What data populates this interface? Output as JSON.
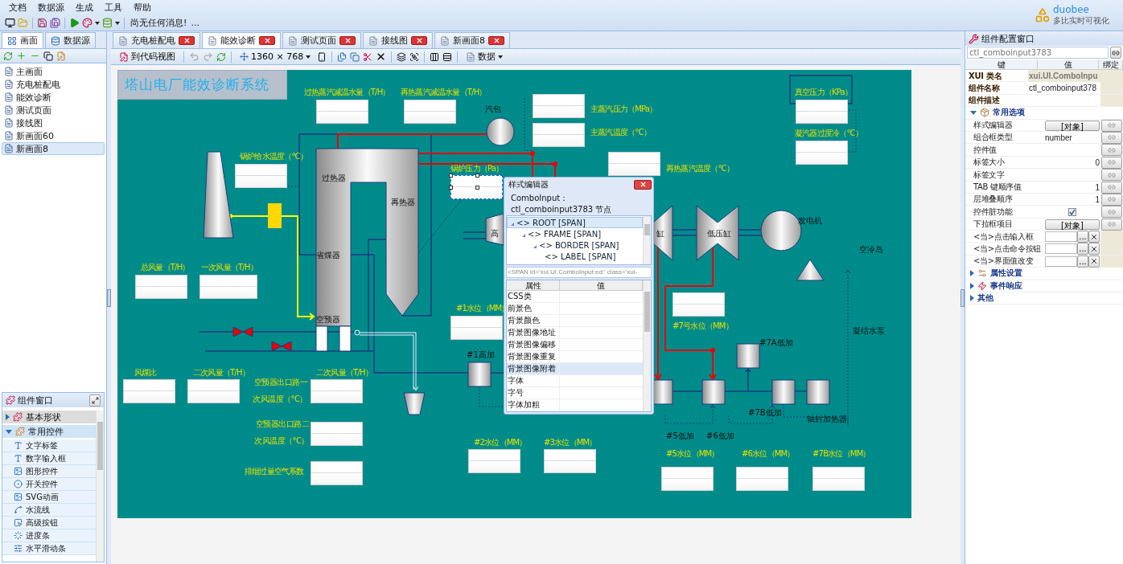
{
  "menu": [
    "文档",
    "数据源",
    "生成",
    "工具",
    "帮助"
  ],
  "toolbar": {
    "message": "尚无任何消息!",
    "more": "..."
  },
  "logo": {
    "name": "duobee",
    "tagline": "多比实时可视化"
  },
  "left_tabs": [
    {
      "label": "画面",
      "selected": true
    },
    {
      "label": "数据源",
      "selected": false
    }
  ],
  "pages": [
    {
      "label": "主画面",
      "selected": false
    },
    {
      "label": "充电桩配电",
      "selected": false
    },
    {
      "label": "能效诊断",
      "selected": false
    },
    {
      "label": "测试页面",
      "selected": false
    },
    {
      "label": "接线图",
      "selected": false
    },
    {
      "label": "新画面60",
      "selected": false
    },
    {
      "label": "新画面8",
      "selected": true
    }
  ],
  "component_window": {
    "title": "组件窗口",
    "groups": [
      {
        "label": "基本形状",
        "expanded": false
      },
      {
        "label": "常用控件",
        "expanded": true,
        "items": [
          "文字标签",
          "数字输入框",
          "图形控件",
          "开关控件",
          "SVG动画",
          "水流线",
          "高级按钮",
          "进度条",
          "水平滑动条"
        ]
      }
    ]
  },
  "doc_tabs": [
    {
      "label": "充电桩配电",
      "selected": false
    },
    {
      "label": "能效诊断",
      "selected": true
    },
    {
      "label": "测试页面",
      "selected": false
    },
    {
      "label": "接线图",
      "selected": false
    },
    {
      "label": "新画面8",
      "selected": false
    }
  ],
  "editor_toolbar": {
    "code_view": "到代码视图",
    "size": "1360 × 768",
    "data": "数据"
  },
  "canvas": {
    "title": "塔山电厂能效诊断系统",
    "gauges": [
      {
        "label": "过热蒸汽减温水量（T/H）",
        "selected": false
      },
      {
        "label": "再热蒸汽减温水量（T/H）",
        "selected": false
      },
      {
        "label": "主蒸汽压力（MPa）",
        "selected": false
      },
      {
        "label": "主蒸汽温度（°C）",
        "selected": false
      },
      {
        "label": "再热蒸汽温度（°C）",
        "selected": false
      },
      {
        "label": "真空压力（KPa）",
        "selected": false
      },
      {
        "label": "凝汽器过度冷（°C）",
        "selected": false
      },
      {
        "label": "锅炉给水温度（°C）",
        "selected": false
      },
      {
        "label": "锅炉压力（Pa）",
        "selected": true
      },
      {
        "label": "总风量（T/H）",
        "selected": false
      },
      {
        "label": "一次风量（T/H）",
        "selected": false
      },
      {
        "label": "#1水位（MM）",
        "selected": false
      },
      {
        "label": "#7号水位（MM）",
        "selected": false
      },
      {
        "label": "风煤比",
        "selected": false
      },
      {
        "label": "二次风量（T/H）",
        "selected": false
      },
      {
        "label": "二次风量（T/H）",
        "selected": false
      },
      {
        "label": "空预器出口路二次风温度（°C）",
        "selected": false
      },
      {
        "label": "排烟过量空气系数",
        "selected": false
      },
      {
        "label": "#2水位（MM）",
        "selected": false
      },
      {
        "label": "#3水位（MM）",
        "selected": false
      },
      {
        "label": "#5水位（MM）",
        "selected": false
      },
      {
        "label": "#6水位（MM）",
        "selected": false
      },
      {
        "label": "#7B水位（MM）",
        "selected": false
      }
    ],
    "labels": [
      {
        "text": "汽包",
        "kind": "equipment"
      },
      {
        "text": "过热器",
        "kind": "equipment"
      },
      {
        "text": "再热器",
        "kind": "equipment"
      },
      {
        "text": "省煤器",
        "kind": "equipment"
      },
      {
        "text": "空预器",
        "kind": "equipment"
      },
      {
        "text": "空预器出口路一次风温度（°C）",
        "kind": "gauge"
      },
      {
        "text": "高",
        "kind": "equipment"
      },
      {
        "text": "缸",
        "kind": "equipment"
      },
      {
        "text": "低压缸",
        "kind": "equipment"
      },
      {
        "text": "发电机",
        "kind": "equipment"
      },
      {
        "text": "空冷岛",
        "kind": "equipment"
      },
      {
        "text": "凝结水泵",
        "kind": "equipment"
      },
      {
        "text": "#1高加",
        "kind": "equipment"
      },
      {
        "text": "#7A低加",
        "kind": "equipment"
      },
      {
        "text": "#7B低加",
        "kind": "equipment"
      },
      {
        "text": "#5低加",
        "kind": "equipment"
      },
      {
        "text": "#6低加",
        "kind": "equipment"
      },
      {
        "text": "轴封加热器",
        "kind": "equipment"
      }
    ]
  },
  "style_editor": {
    "title": "样式编辑器",
    "subtitle": "ComboInput：ctl_comboinput3783 节点",
    "tree": [
      {
        "label": "<> ROOT [SPAN]",
        "selected": true,
        "expanded": true,
        "children": [
          {
            "label": "<> FRAME [SPAN]",
            "selected": false,
            "expanded": true,
            "children": [
              {
                "label": "<> BORDER [SPAN]",
                "selected": false,
                "expanded": true,
                "children": [
                  {
                    "label": "<> LABEL [SPAN]",
                    "selected": false
                  }
                ]
              }
            ]
          }
        ]
      }
    ],
    "path": "<SPAN id='xui.UI.ComboInput:ed:' class='xui-",
    "columns": [
      "属性",
      "值"
    ],
    "rows": [
      {
        "label": "CSS类",
        "selected": false
      },
      {
        "label": "前景色",
        "selected": false
      },
      {
        "label": "背景颜色",
        "selected": false
      },
      {
        "label": "背景图像地址",
        "selected": false
      },
      {
        "label": "背景图像偏移",
        "selected": false
      },
      {
        "label": "背景图像重复",
        "selected": false
      },
      {
        "label": "背景图像附着",
        "selected": true
      },
      {
        "label": "字体",
        "selected": false
      },
      {
        "label": "字号",
        "selected": false
      },
      {
        "label": "字体加粗",
        "selected": false
      }
    ]
  },
  "config": {
    "title": "组件配置窗口",
    "id_value": "ctl_comboinput3783",
    "columns": [
      "键",
      "值",
      "绑定"
    ],
    "header_rows": [
      {
        "key": "XUI 类名",
        "value": "xui.UI.ComboInpu"
      },
      {
        "key": "组件名称",
        "value": "ctl_comboinput378"
      },
      {
        "key": "组件描述"
      }
    ],
    "groups": [
      {
        "label": "常用选项",
        "expanded": true,
        "rows": [
          {
            "kind": "button",
            "key": "样式编辑器",
            "value": "[对象]"
          },
          {
            "kind": "text",
            "key": "组合框类型",
            "value": "number"
          },
          {
            "kind": "text",
            "key": "控件值"
          },
          {
            "kind": "number",
            "key": "标签大小",
            "value": "0"
          },
          {
            "kind": "text",
            "key": "标签文字"
          },
          {
            "kind": "number",
            "key": "TAB 键顺序值",
            "value": "1"
          },
          {
            "kind": "number",
            "key": "层堆叠顺序",
            "value": "1"
          },
          {
            "kind": "checkbox",
            "key": "控件脏功能",
            "checked": true
          },
          {
            "kind": "button",
            "key": "下拉框项目",
            "value": "[对象]"
          },
          {
            "kind": "event",
            "key": "<当>点击输入框",
            "button": "..."
          },
          {
            "kind": "event",
            "key": "<当>点击命令按钮",
            "button": "..."
          },
          {
            "kind": "event",
            "key": "<当>界面值改变",
            "button": "..."
          }
        ]
      },
      {
        "label": "属性设置",
        "expanded": false
      },
      {
        "label": "事件响应",
        "expanded": false
      },
      {
        "label": "其他",
        "expanded": false
      }
    ]
  }
}
